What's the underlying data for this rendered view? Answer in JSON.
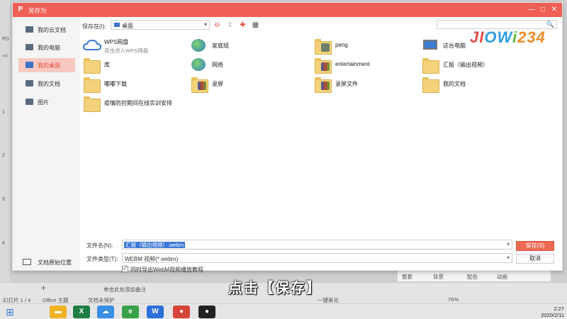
{
  "dialog": {
    "title": "另存为",
    "logo_glyph": "P",
    "minimize_glyph": "—",
    "maximize_glyph": "□",
    "close_glyph": "✕"
  },
  "sidebar": {
    "items": [
      {
        "label": "我的云文档",
        "icon": "cloud-doc-icon"
      },
      {
        "label": "我的电脑",
        "icon": "computer-icon"
      },
      {
        "label": "我的桌面",
        "icon": "desktop-icon",
        "active": true
      },
      {
        "label": "我的文档",
        "icon": "documents-icon"
      },
      {
        "label": "图片",
        "icon": "pictures-icon"
      }
    ],
    "bottom_label": "文档原始位置"
  },
  "toolbar": {
    "save_in_label": "保存在(I):",
    "location_value": "桌面",
    "location_chevron": "▾",
    "back_glyph": "⊖",
    "up_glyph": "⇧",
    "new_folder_glyph": "✚",
    "view_glyph": "▦",
    "search_glyph": "🔍"
  },
  "files": [
    {
      "name": "WPS网盘",
      "sub": "双击进入WPS网盘",
      "type": "cloud"
    },
    {
      "name": "家庭组",
      "sub": "",
      "type": "network"
    },
    {
      "name": "peng",
      "sub": "",
      "type": "folder"
    },
    {
      "name": "这台电脑",
      "sub": "",
      "type": "computer"
    },
    {
      "name": "库",
      "sub": "",
      "type": "folder"
    },
    {
      "name": "网络",
      "sub": "",
      "type": "network"
    },
    {
      "name": "entertainment",
      "sub": "",
      "type": "folder"
    },
    {
      "name": "汇报（输出视频）",
      "sub": "",
      "type": "folder"
    },
    {
      "name": "嘟嘟下载",
      "sub": "",
      "type": "folder"
    },
    {
      "name": "录屏",
      "sub": "",
      "type": "folder"
    },
    {
      "name": "录屏文件",
      "sub": "",
      "type": "folder"
    },
    {
      "name": "我的文档",
      "sub": "",
      "type": "folder"
    },
    {
      "name": "疫情防控期间在线实训安排",
      "sub": "",
      "type": "folder"
    }
  ],
  "form": {
    "filename_label": "文件名(N):",
    "filename_value": "汇报（输出视频）.webm",
    "filetype_label": "文件类型(T):",
    "filetype_value": "WEBM 视频(*.webm)",
    "export_checkbox_checked": true,
    "export_checkbox_glyph": "✓",
    "export_label": "同时导出WebM视频播放教程",
    "save_label": "保存(S)",
    "cancel_label": "取消",
    "chevron": "▾"
  },
  "watermark": {
    "part1": "JI",
    "part2": "OW",
    "part3": "i",
    "part4": "234"
  },
  "caption": "点击【保存】",
  "background_app": {
    "left_marks": [
      "PD",
      "<<",
      "1",
      "2",
      "3",
      "4"
    ],
    "slide_count": "幻灯片 1 / 4",
    "theme": "Office 主题",
    "protection": "文档未保护",
    "notes_hint": "单击此处添加备注",
    "add_glyph": "+",
    "beautify": "一键美化",
    "zoom": "76%",
    "mini_toolbar": [
      "整套",
      "背景",
      "配色",
      "动画"
    ]
  },
  "taskbar": {
    "start_glyph": "⊞",
    "apps": [
      {
        "name": "file-explorer",
        "glyph": "▬",
        "color": "#f0b323"
      },
      {
        "name": "excel",
        "glyph": "X",
        "color": "#1e7e45"
      },
      {
        "name": "baidu-netdisk",
        "glyph": "☁",
        "color": "#3a8ee6"
      },
      {
        "name": "ie-browser",
        "glyph": "e",
        "color": "#3aa14a"
      },
      {
        "name": "wps",
        "glyph": "W",
        "color": "#2f6fd8"
      },
      {
        "name": "chrome",
        "glyph": "●",
        "color": "#d6453a"
      },
      {
        "name": "recorder",
        "glyph": "●",
        "color": "#b01e1e"
      }
    ],
    "time": "2:27",
    "date": "2020/2/11"
  },
  "colors": {
    "accent": "#ef5f55",
    "selected_sidebar": "#f7c9c1",
    "selection_blue": "#3a78d4"
  }
}
